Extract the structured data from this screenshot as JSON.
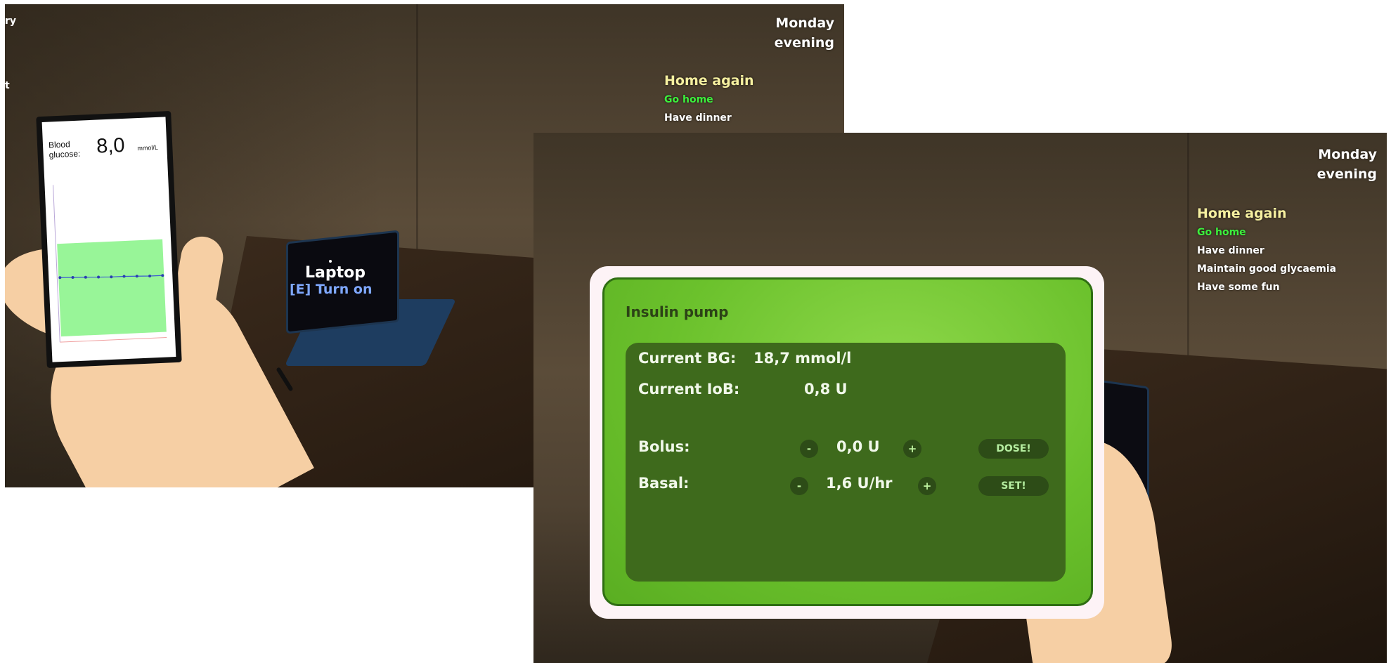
{
  "left_scene": {
    "hud": {
      "day": "Monday",
      "time_of_day": "evening",
      "partial_left_text_1": "ry",
      "partial_left_text_2": "t"
    },
    "quests": {
      "title": "Home again",
      "completed": [
        "Go home"
      ],
      "pending": [
        "Have dinner"
      ]
    },
    "phone": {
      "label": "Blood glucose:",
      "value": "8,0",
      "unit": "mmol/L",
      "chart_data": {
        "type": "line",
        "title": "",
        "xlabel": "",
        "ylabel": "",
        "grid": false,
        "target_band": "green",
        "values": [
          8.2,
          8.15,
          8.1,
          8.05,
          8.0,
          8.0,
          7.95,
          7.9,
          7.9
        ]
      }
    },
    "laptop_prompt": {
      "object": "Laptop",
      "key": "[E]",
      "action": "Turn on"
    }
  },
  "right_scene": {
    "hud": {
      "day": "Monday",
      "time_of_day": "evening"
    },
    "quests": {
      "title": "Home again",
      "completed": [
        "Go home"
      ],
      "pending": [
        "Have dinner",
        "Maintain good glycaemia",
        "Have some fun"
      ]
    },
    "insulin_pump": {
      "title": "Insulin pump",
      "current_bg_label": "Current BG:",
      "current_bg_value": "18,7 mmol/l",
      "current_iob_label": "Current IoB:",
      "current_iob_value": "0,8 U",
      "bolus_label": "Bolus:",
      "bolus_value": "0,0 U",
      "bolus_minus": "-",
      "bolus_plus": "+",
      "dose_button": "DOSE!",
      "basal_label": "Basal:",
      "basal_value": "1,6 U/hr",
      "basal_minus": "-",
      "basal_plus": "+",
      "set_button": "SET!"
    }
  },
  "colors": {
    "quest_title": "#f6f0a0",
    "quest_completed": "#3cf03c",
    "quest_pending": "#ffffff",
    "pump_green": "#6bc12c",
    "pump_panel": "#3e6a1c",
    "glucose_band": "#98f598",
    "prompt_blue": "#7fa8ff"
  }
}
